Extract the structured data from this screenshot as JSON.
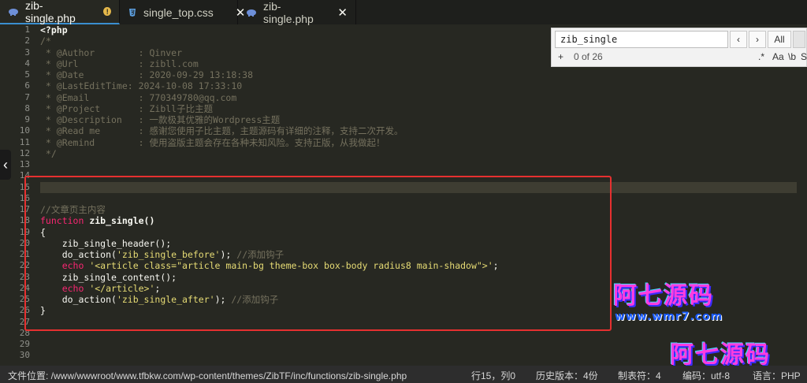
{
  "tabs": [
    {
      "label": "zib-single.php",
      "icon": "php-elephant-icon",
      "active": true,
      "modified": true
    },
    {
      "label": "single_top.css",
      "icon": "css-icon",
      "active": false
    },
    {
      "label": "zib-single.php",
      "icon": "php-elephant-icon",
      "active": false
    }
  ],
  "find": {
    "query": "zib_single",
    "prev": "‹",
    "next": "›",
    "all": "All",
    "add": "+",
    "count": "0 of 26",
    "regex": ".*",
    "case": "Aa",
    "word": "\\b",
    "sel": "S"
  },
  "line_numbers": [
    "1",
    "2",
    "3",
    "4",
    "5",
    "6",
    "7",
    "8",
    "9",
    "10",
    "11",
    "12",
    "13",
    "14",
    "15",
    "16",
    "17",
    "18",
    "19",
    "20",
    "21",
    "22",
    "23",
    "24",
    "25",
    "26",
    "27",
    "28",
    "29",
    "30"
  ],
  "code": {
    "l1": "<?php",
    "l2": "/*",
    "l3": " * @Author        : Qinver",
    "l4": " * @Url           : zibll.com",
    "l5": " * @Date          : 2020-09-29 13:18:38",
    "l6": " * @LastEditTime: 2024-10-08 17:33:10",
    "l7": " * @Email         : 770349780@qq.com",
    "l8": " * @Project       : Zibll子比主题",
    "l9": " * @Description   : 一款极其优雅的Wordpress主题",
    "l10": " * @Read me       : 感谢您使用子比主题，主题源码有详细的注释，支持二次开发。",
    "l11": " * @Remind        : 使用盗版主题会存在各种未知风险。支持正版，从我做起！",
    "l12": " */",
    "l16": "//文章页主内容",
    "l17_kw": "function",
    "l17_fn": " zib_single()",
    "l18": "{",
    "l19": "    zib_single_header();",
    "l20_a": "    do_action(",
    "l20_s": "'zib_single_before'",
    "l20_b": "); ",
    "l20_c": "//添加钩子",
    "l21_kw": "    echo",
    "l21_s": " '<article class=\"article main-bg theme-box box-body radius8 main-shadow\">'",
    "l21_b": ";",
    "l22": "    zib_single_content();",
    "l23_kw": "    echo",
    "l23_s": " '</article>'",
    "l23_b": ";",
    "l24_a": "    do_action(",
    "l24_s": "'zib_single_after'",
    "l24_b": "); ",
    "l24_c": "//添加钩子",
    "l25": "}"
  },
  "watermark": {
    "text": "阿七源码",
    "url": "www.wmr7.com"
  },
  "status": {
    "path": "文件位置: /www/wwwroot/www.tfbkw.com/wp-content/themes/ZibTF/inc/functions/zib-single.php",
    "cursor": "行15，列0",
    "history": "历史版本：4份",
    "tab": "制表符：4",
    "encoding": "编码：utf-8",
    "language": "语言：PHP"
  },
  "colors": {
    "background": "#272822",
    "highlight_box": "#e63030",
    "keyword": "#f92672",
    "string": "#e6db74",
    "comment": "#75715e"
  }
}
